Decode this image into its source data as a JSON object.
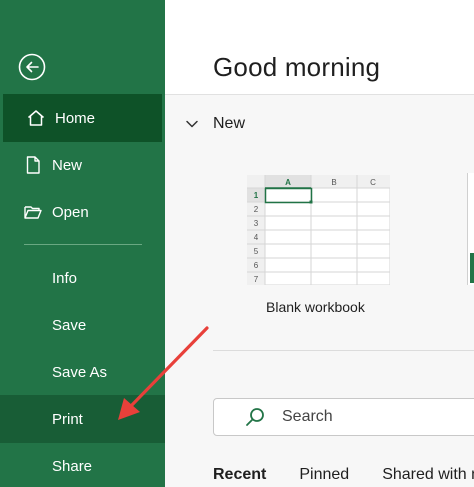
{
  "sidebar": {
    "items": [
      {
        "label": "Home",
        "icon": "home-icon"
      },
      {
        "label": "New",
        "icon": "new-file-icon"
      },
      {
        "label": "Open",
        "icon": "folder-open-icon"
      },
      {
        "label": "Info"
      },
      {
        "label": "Save"
      },
      {
        "label": "Save As"
      },
      {
        "label": "Print"
      },
      {
        "label": "Share"
      }
    ]
  },
  "main": {
    "greeting": "Good morning",
    "new_section": {
      "title": "New",
      "templates": [
        {
          "label": "Blank workbook",
          "columns": [
            "A",
            "B",
            "C"
          ],
          "rows": [
            "1",
            "2",
            "3",
            "4",
            "5",
            "6",
            "7"
          ]
        }
      ]
    },
    "search": {
      "placeholder": "Search"
    },
    "tabs": [
      {
        "label": "Recent"
      },
      {
        "label": "Pinned"
      },
      {
        "label": "Shared with me"
      }
    ]
  },
  "colors": {
    "sidebar_bg": "#227447",
    "sidebar_active": "#0e5228",
    "annotation_arrow": "#e8403a"
  }
}
